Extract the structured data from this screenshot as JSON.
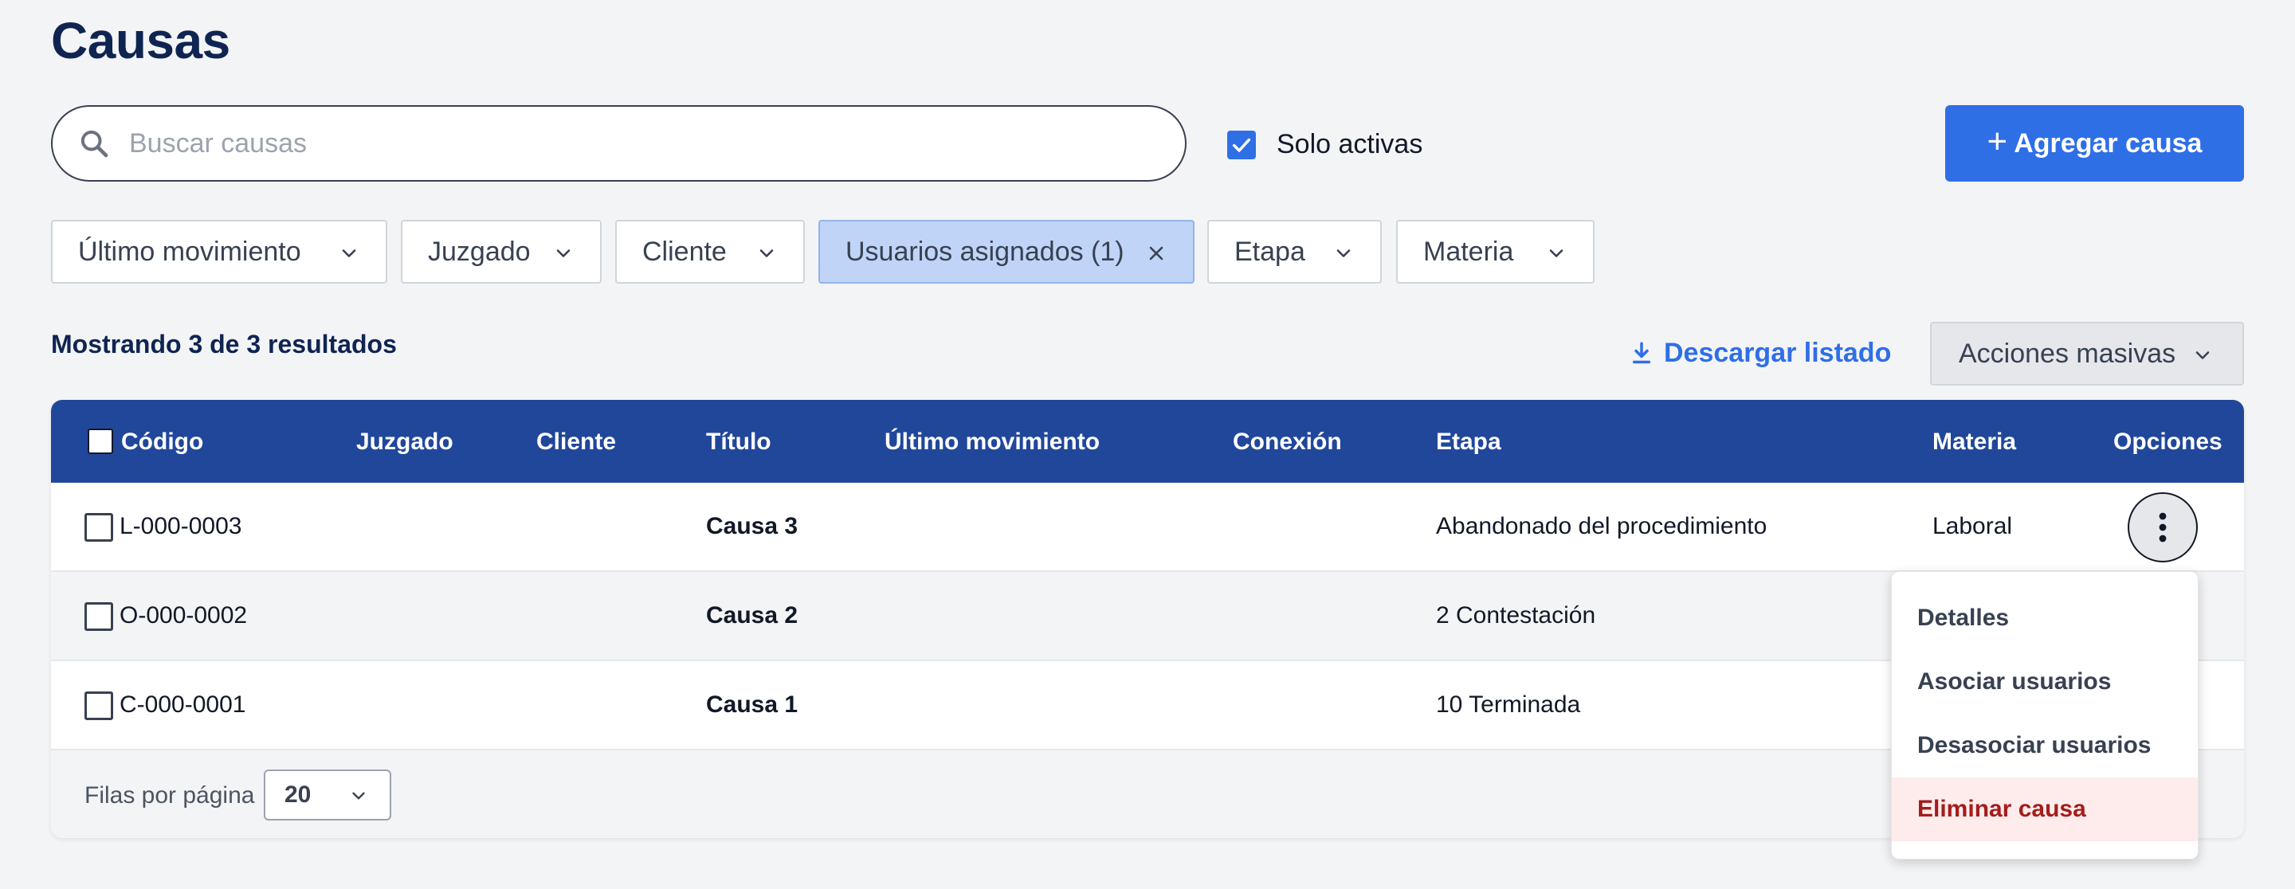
{
  "page": {
    "title": "Causas"
  },
  "search": {
    "placeholder": "Buscar causas",
    "value": ""
  },
  "solo_activas": {
    "label": "Solo activas",
    "checked": true
  },
  "add_button": {
    "label": "Agregar causa"
  },
  "filters": [
    {
      "label": "Último movimiento"
    },
    {
      "label": "Juzgado"
    },
    {
      "label": "Cliente"
    },
    {
      "label": "Usuarios asignados (1)",
      "active": true
    },
    {
      "label": "Etapa"
    },
    {
      "label": "Materia"
    }
  ],
  "results": {
    "text": "Mostrando 3 de 3 resultados"
  },
  "download": {
    "label": "Descargar listado"
  },
  "bulk_actions": {
    "label": "Acciones masivas"
  },
  "table": {
    "headers": {
      "codigo": "Código",
      "juzgado": "Juzgado",
      "cliente": "Cliente",
      "titulo": "Título",
      "ultimo_movimiento": "Último movimiento",
      "conexion": "Conexión",
      "etapa": "Etapa",
      "materia": "Materia",
      "opciones": "Opciones"
    },
    "rows": [
      {
        "codigo": "L-000-0003",
        "juzgado": "",
        "cliente": "",
        "titulo": "Causa 3",
        "ultimo_movimiento": "",
        "conexion": "",
        "etapa": "Abandonado del procedimiento",
        "materia": "Laboral"
      },
      {
        "codigo": "O-000-0002",
        "juzgado": "",
        "cliente": "",
        "titulo": "Causa 2",
        "ultimo_movimiento": "",
        "conexion": "",
        "etapa": "2 Contestación",
        "materia": ""
      },
      {
        "codigo": "C-000-0001",
        "juzgado": "",
        "cliente": "",
        "titulo": "Causa 1",
        "ultimo_movimiento": "",
        "conexion": "",
        "etapa": "10 Terminada",
        "materia": ""
      }
    ]
  },
  "pagination": {
    "rows_per_page_label": "Filas por página",
    "rows_per_page_value": "20"
  },
  "options_menu": {
    "items": [
      {
        "label": "Detalles"
      },
      {
        "label": "Asociar usuarios"
      },
      {
        "label": "Desasociar usuarios"
      },
      {
        "label": "Eliminar causa",
        "danger": true
      }
    ]
  },
  "colors": {
    "primary": "#2f6fe6",
    "header_bg": "#21479b",
    "title": "#0f2451",
    "active_filter_bg": "#bfd4f7",
    "danger": "#a51c1c",
    "danger_bg": "#fdeceb"
  }
}
